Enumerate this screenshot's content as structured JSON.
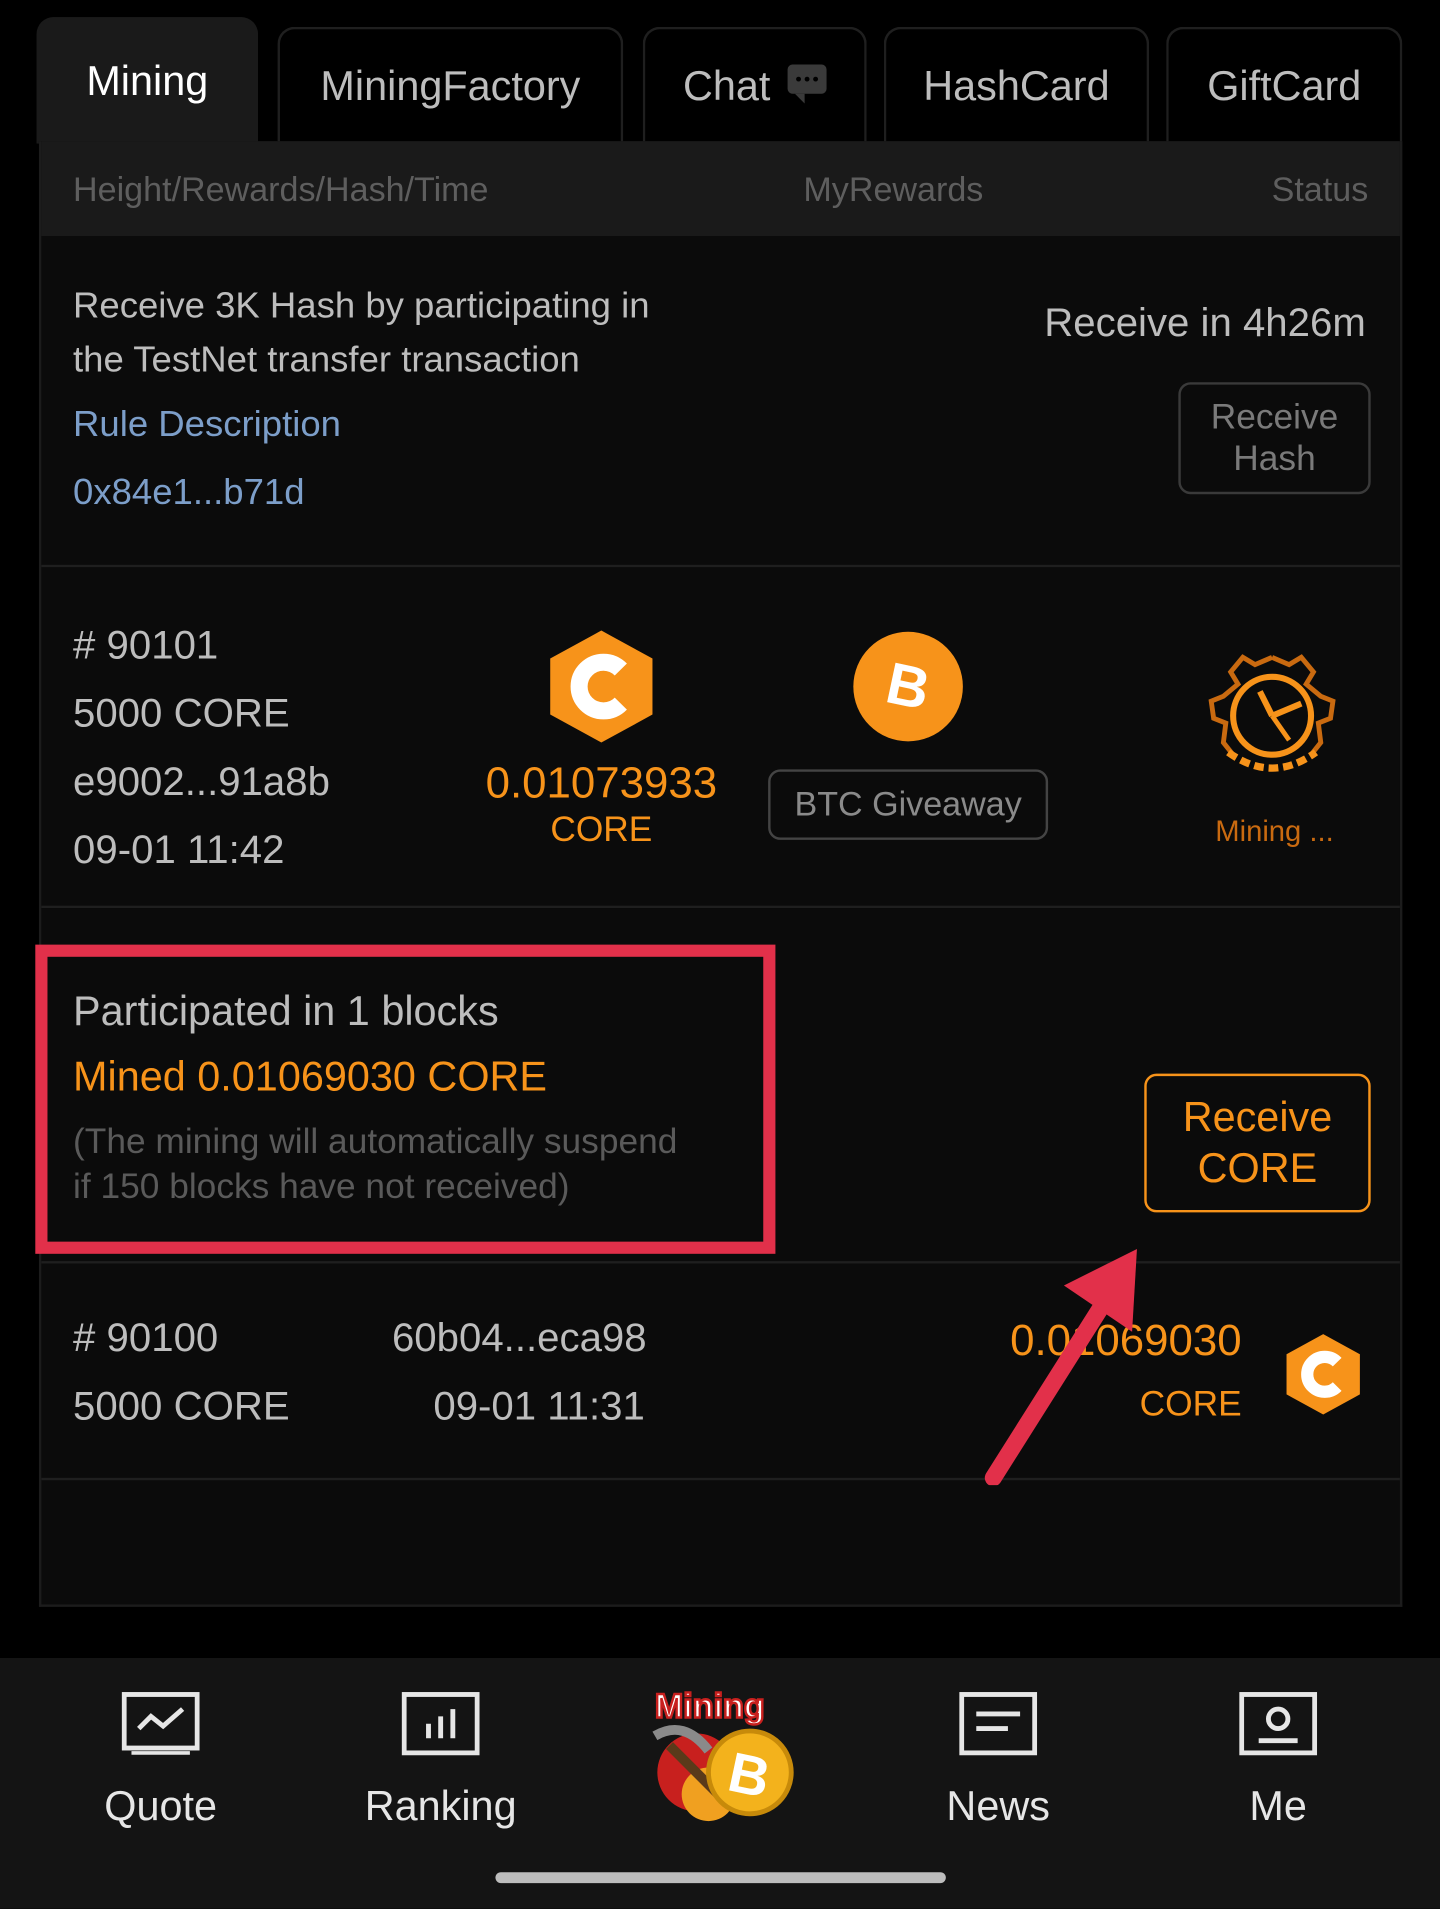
{
  "tabs": [
    {
      "label": "Mining",
      "active": true
    },
    {
      "label": "MiningFactory",
      "active": false
    },
    {
      "label": "Chat",
      "active": false
    },
    {
      "label": "HashCard",
      "active": false
    },
    {
      "label": "GiftCard",
      "active": false
    }
  ],
  "table_header": {
    "col1": "Height/Rewards/Hash/Time",
    "col2": "MyRewards",
    "col3": "Status"
  },
  "promo": {
    "line1": "Receive 3K Hash by participating in",
    "line2": "the TestNet transfer transaction",
    "rule_link": "Rule Description",
    "address": "0x84e1...b71d",
    "countdown": "Receive in 4h26m",
    "btn_line1": "Receive",
    "btn_line2": "Hash"
  },
  "current_block": {
    "height": "# 90101",
    "reward": "5000 CORE",
    "hash": "e9002...91a8b",
    "time": "09-01 11:42",
    "my_reward": "0.01073933",
    "my_reward_unit": "CORE",
    "giveaway_label": "BTC Giveaway",
    "status": "Mining ..."
  },
  "summary": {
    "participated": "Participated in 1 blocks",
    "mined": "Mined 0.01069030 CORE",
    "note_line1": "(The mining will automatically suspend",
    "note_line2": "if 150 blocks have not received)",
    "btn_line1": "Receive",
    "btn_line2": "CORE"
  },
  "past_block": {
    "height": "# 90100",
    "reward": "5000 CORE",
    "hash": "60b04...eca98",
    "time": "09-01 11:31",
    "amount": "0.01069030",
    "unit": "CORE"
  },
  "bottom_nav": {
    "quote": "Quote",
    "ranking": "Ranking",
    "center_badge": "Mining",
    "news": "News",
    "me": "Me"
  },
  "colors": {
    "accent": "#f7931a",
    "highlight": "#e2304a",
    "link": "#7c9ec9"
  }
}
